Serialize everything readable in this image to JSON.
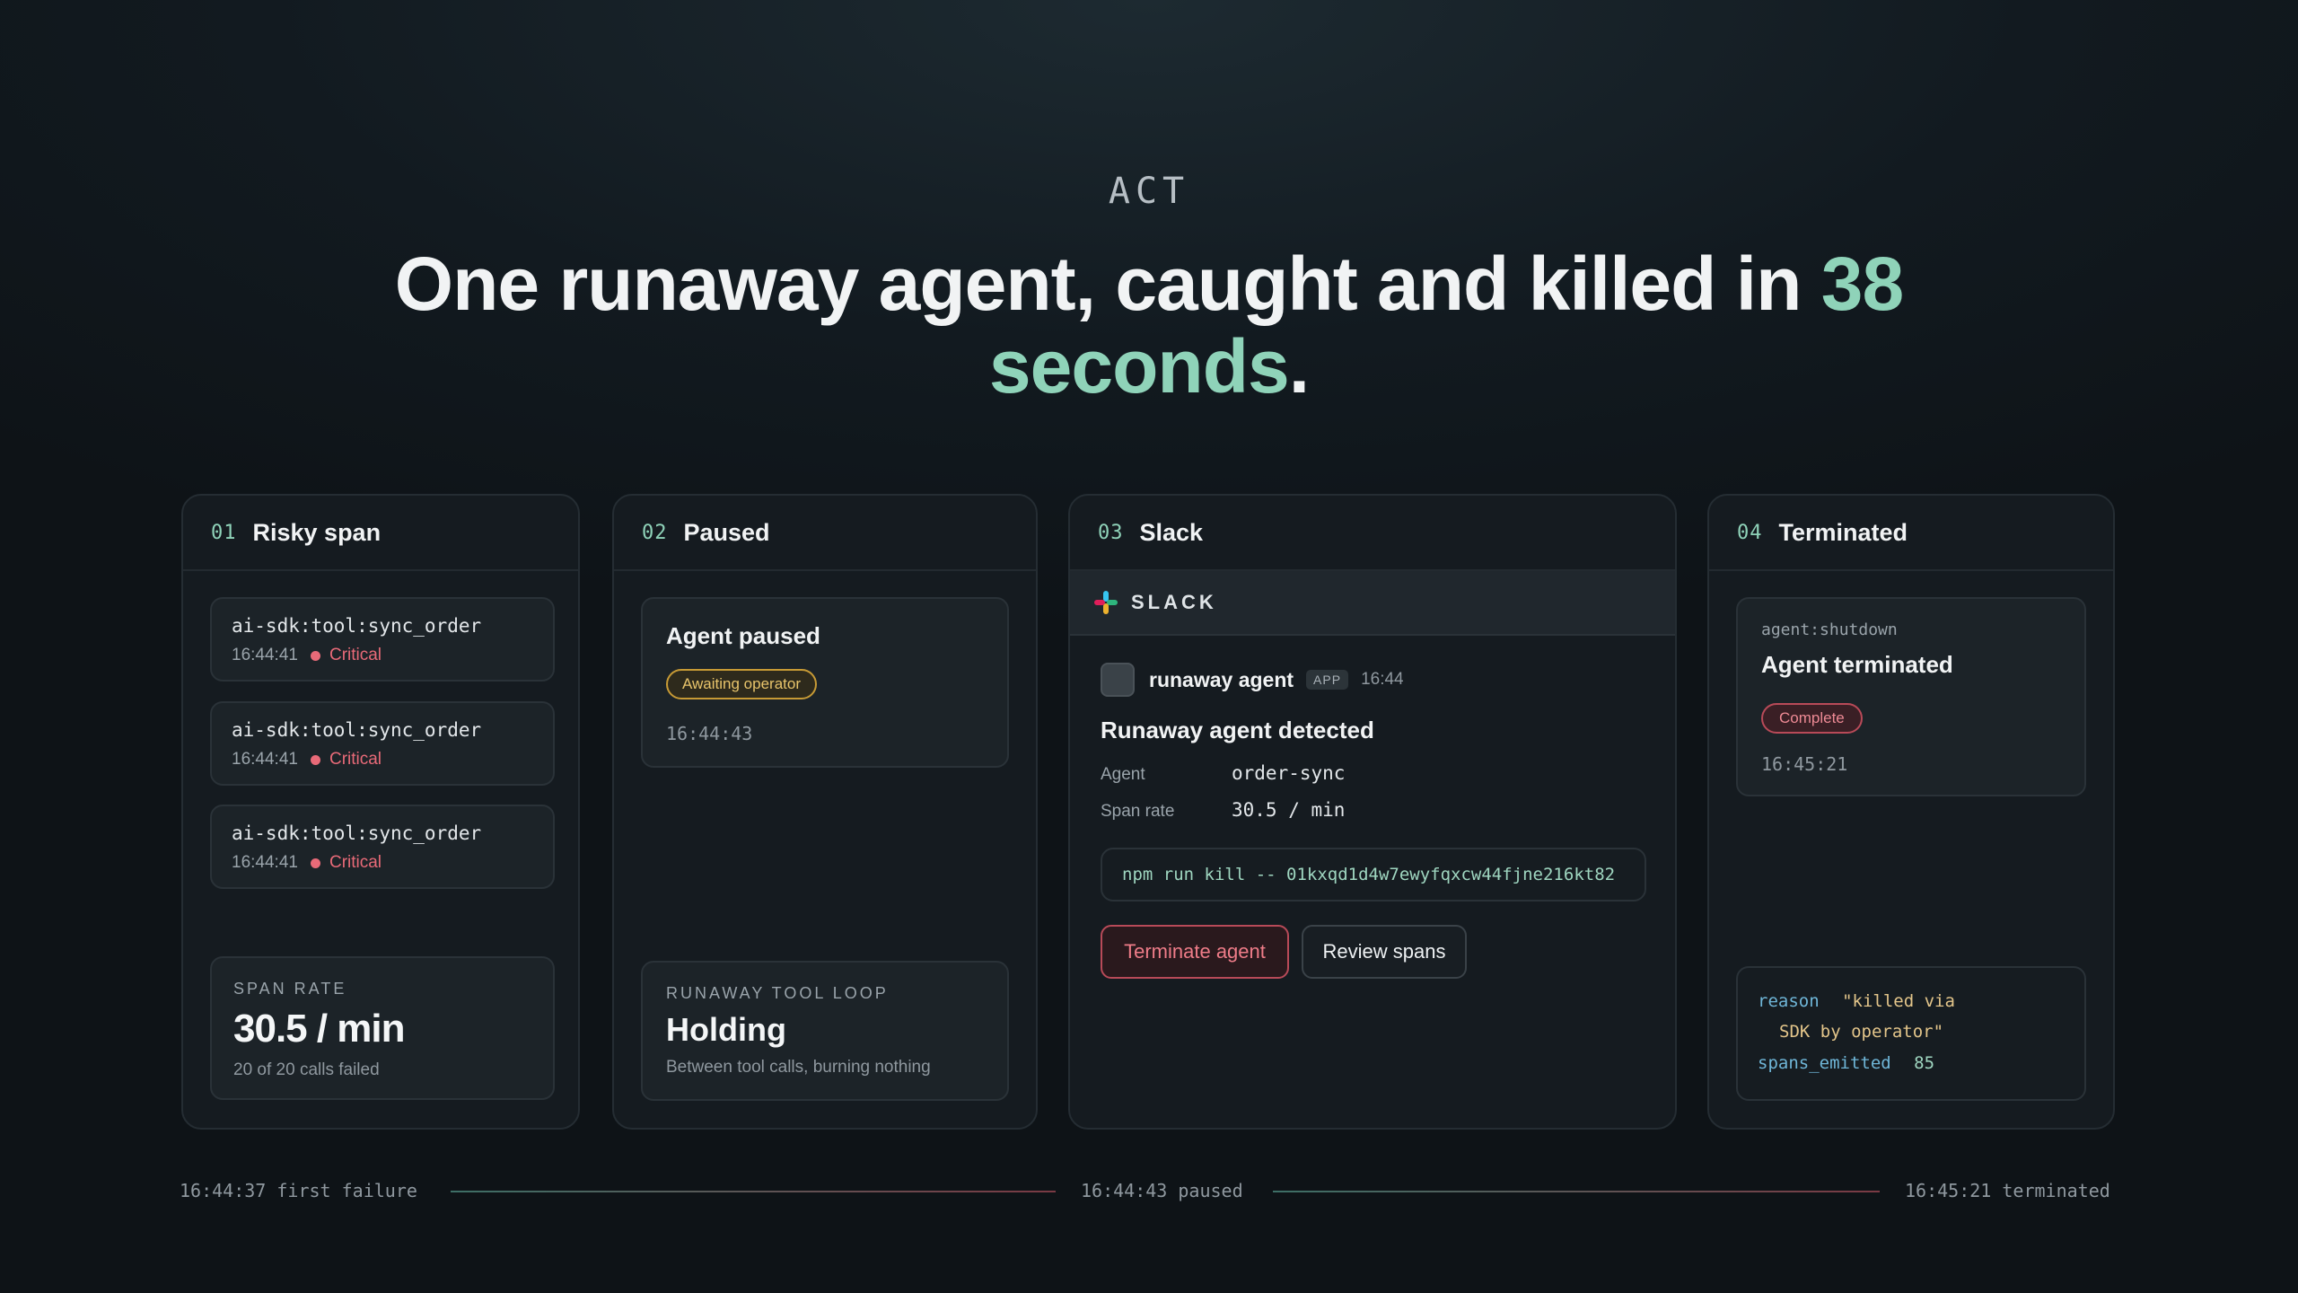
{
  "eyebrow": "ACT",
  "headline": {
    "text": "One runaway agent, caught and killed in ",
    "accent": "38 seconds",
    "end": "."
  },
  "cards": {
    "risky": {
      "num": "01",
      "title": "Risky span",
      "spans": [
        {
          "name": "ai-sdk:tool:sync_order",
          "time": "16:44:41",
          "severity": "Critical"
        },
        {
          "name": "ai-sdk:tool:sync_order",
          "time": "16:44:41",
          "severity": "Critical"
        },
        {
          "name": "ai-sdk:tool:sync_order",
          "time": "16:44:41",
          "severity": "Critical"
        }
      ],
      "rate_label": "SPAN RATE",
      "rate_value": "30.5 / min",
      "rate_sub": "20 of 20 calls failed"
    },
    "paused": {
      "num": "02",
      "title": "Paused",
      "status_title": "Agent paused",
      "status_badge": "Awaiting operator",
      "status_time": "16:44:43",
      "loop_label": "RUNAWAY TOOL LOOP",
      "loop_value": "Holding",
      "loop_sub": "Between tool calls, burning nothing"
    },
    "slack": {
      "num": "03",
      "title": "Slack",
      "bar_label": "SLACK",
      "sender": "runaway agent",
      "app_tag": "APP",
      "time": "16:44",
      "message_title": "Runaway agent detected",
      "fields": [
        {
          "key": "Agent",
          "value": "order-sync"
        },
        {
          "key": "Span rate",
          "value": "30.5 / min"
        }
      ],
      "command": "npm run kill -- 01kxqd1d4w7ewyfqxcw44fjne216kt82",
      "terminate_label": "Terminate agent",
      "review_label": "Review spans"
    },
    "terminated": {
      "num": "04",
      "title": "Terminated",
      "event": "agent:shutdown",
      "status_title": "Agent terminated",
      "status_badge": "Complete",
      "status_time": "16:45:21",
      "log": {
        "reason_key": "reason",
        "reason_val_1": "\"killed via",
        "reason_val_2": "SDK by operator\"",
        "spans_key": "spans_emitted",
        "spans_val": "85"
      }
    }
  },
  "timeline": {
    "start": "16:44:37 first failure",
    "mid": "16:44:43 paused",
    "end": "16:45:21 terminated"
  },
  "colors": {
    "accent": "#8fd3b9",
    "critical": "#e86a78",
    "warn": "#e8c46b"
  }
}
